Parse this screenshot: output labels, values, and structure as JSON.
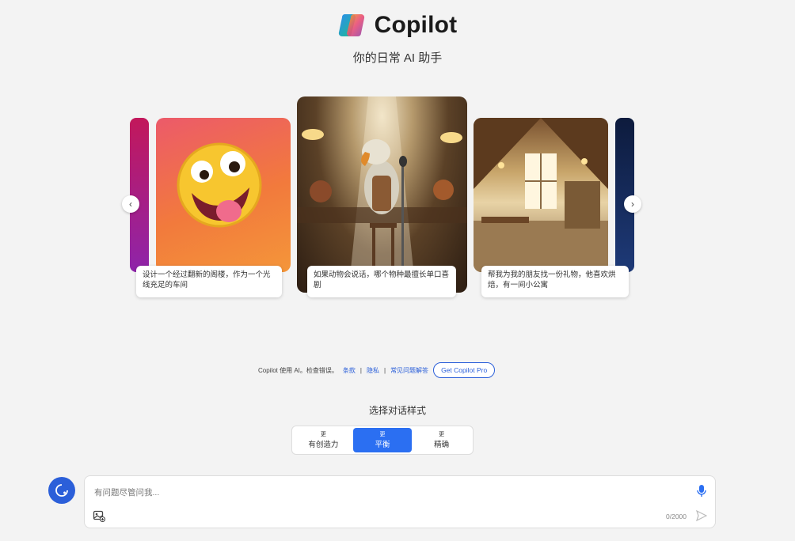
{
  "header": {
    "brand": "Copilot",
    "tagline": "你的日常 AI 助手"
  },
  "carousel": {
    "cards": [
      {
        "caption": "设计一个经过翻新的阁楼，作为一个光线充足的车间"
      },
      {
        "caption": "如果动物会说话，哪个物种最擅长单口喜剧"
      },
      {
        "caption": "帮我为我的朋友找一份礼物，他喜欢烘焙，有一间小公寓"
      }
    ],
    "prev_icon": "chevron-left-icon",
    "next_icon": "chevron-right-icon"
  },
  "disclaimer": {
    "text": "Copilot 使用 AI。检查错误。",
    "link_terms": "条款",
    "sep": "|",
    "link_privacy": "隐私",
    "link_faq": "常见问题解答",
    "pro_button": "Get Copilot Pro"
  },
  "conversation_style": {
    "label": "选择对话样式",
    "options": [
      {
        "tick": "更",
        "label": "有创造力"
      },
      {
        "tick": "更",
        "label": "平衡"
      },
      {
        "tick": "更",
        "label": "精确"
      }
    ],
    "selected": "平衡"
  },
  "input": {
    "placeholder": "有问题尽管问我...",
    "counter": "0/2000"
  },
  "colors": {
    "accent": "#2b6ff2",
    "link": "#2b5fd9",
    "background": "#f3f3f3"
  }
}
